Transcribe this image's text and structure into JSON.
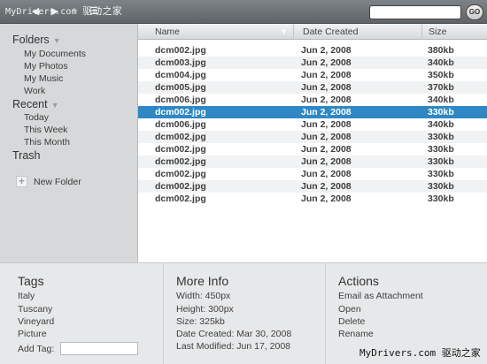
{
  "toolbar": {
    "watermark_left": "MyDrivers.com",
    "watermark_right": "驱动之家",
    "search": {
      "value": "",
      "placeholder": ""
    },
    "go_label": "GO"
  },
  "sidebar": {
    "folders_heading": "Folders",
    "folders": [
      "My Documents",
      "My Photos",
      "My Music",
      "Work"
    ],
    "recent_heading": "Recent",
    "recent": [
      "Today",
      "This Week",
      "This Month"
    ],
    "trash": "Trash",
    "new_folder": "New Folder"
  },
  "filelist": {
    "columns": [
      "Name",
      "Date Created",
      "Size"
    ],
    "rows": [
      {
        "name": "dcm002.jpg",
        "date": "Jun 2, 2008",
        "size": "380kb"
      },
      {
        "name": "dcm003.jpg",
        "date": "Jun 2, 2008",
        "size": "340kb"
      },
      {
        "name": "dcm004.jpg",
        "date": "Jun 2, 2008",
        "size": "350kb"
      },
      {
        "name": "dcm005.jpg",
        "date": "Jun 2, 2008",
        "size": "370kb"
      },
      {
        "name": "dcm006.jpg",
        "date": "Jun 2, 2008",
        "size": "340kb"
      },
      {
        "name": "dcm002.jpg",
        "date": "Jun 2, 2008",
        "size": "330kb"
      },
      {
        "name": "dcm006.jpg",
        "date": "Jun 2, 2008",
        "size": "340kb"
      },
      {
        "name": "dcm002.jpg",
        "date": "Jun 2, 2008",
        "size": "330kb"
      },
      {
        "name": "dcm002.jpg",
        "date": "Jun 2, 2008",
        "size": "330kb"
      },
      {
        "name": "dcm002.jpg",
        "date": "Jun 2, 2008",
        "size": "330kb"
      },
      {
        "name": "dcm002.jpg",
        "date": "Jun 2, 2008",
        "size": "330kb"
      },
      {
        "name": "dcm002.jpg",
        "date": "Jun 2, 2008",
        "size": "330kb"
      },
      {
        "name": "dcm002.jpg",
        "date": "Jun 2, 2008",
        "size": "330kb"
      }
    ],
    "selected_index": 5,
    "selection_color": "#2f88c4"
  },
  "tags": {
    "heading": "Tags",
    "items": [
      "Italy",
      "Tuscany",
      "Vineyard",
      "Picture"
    ],
    "add_label": "Add Tag:",
    "add_value": ""
  },
  "info": {
    "heading": "More Info",
    "lines": [
      "Width: 450px",
      "Height: 300px",
      "Size: 325kb",
      "Date Created: Mar 30, 2008",
      "Last Modified: Jun 17, 2008"
    ]
  },
  "actions": {
    "heading": "Actions",
    "items": [
      "Email as Attachment",
      "Open",
      "Delete",
      "Rename"
    ]
  },
  "footer_watermark": {
    "left": "MyDrivers.com",
    "right": "驱动之家"
  }
}
